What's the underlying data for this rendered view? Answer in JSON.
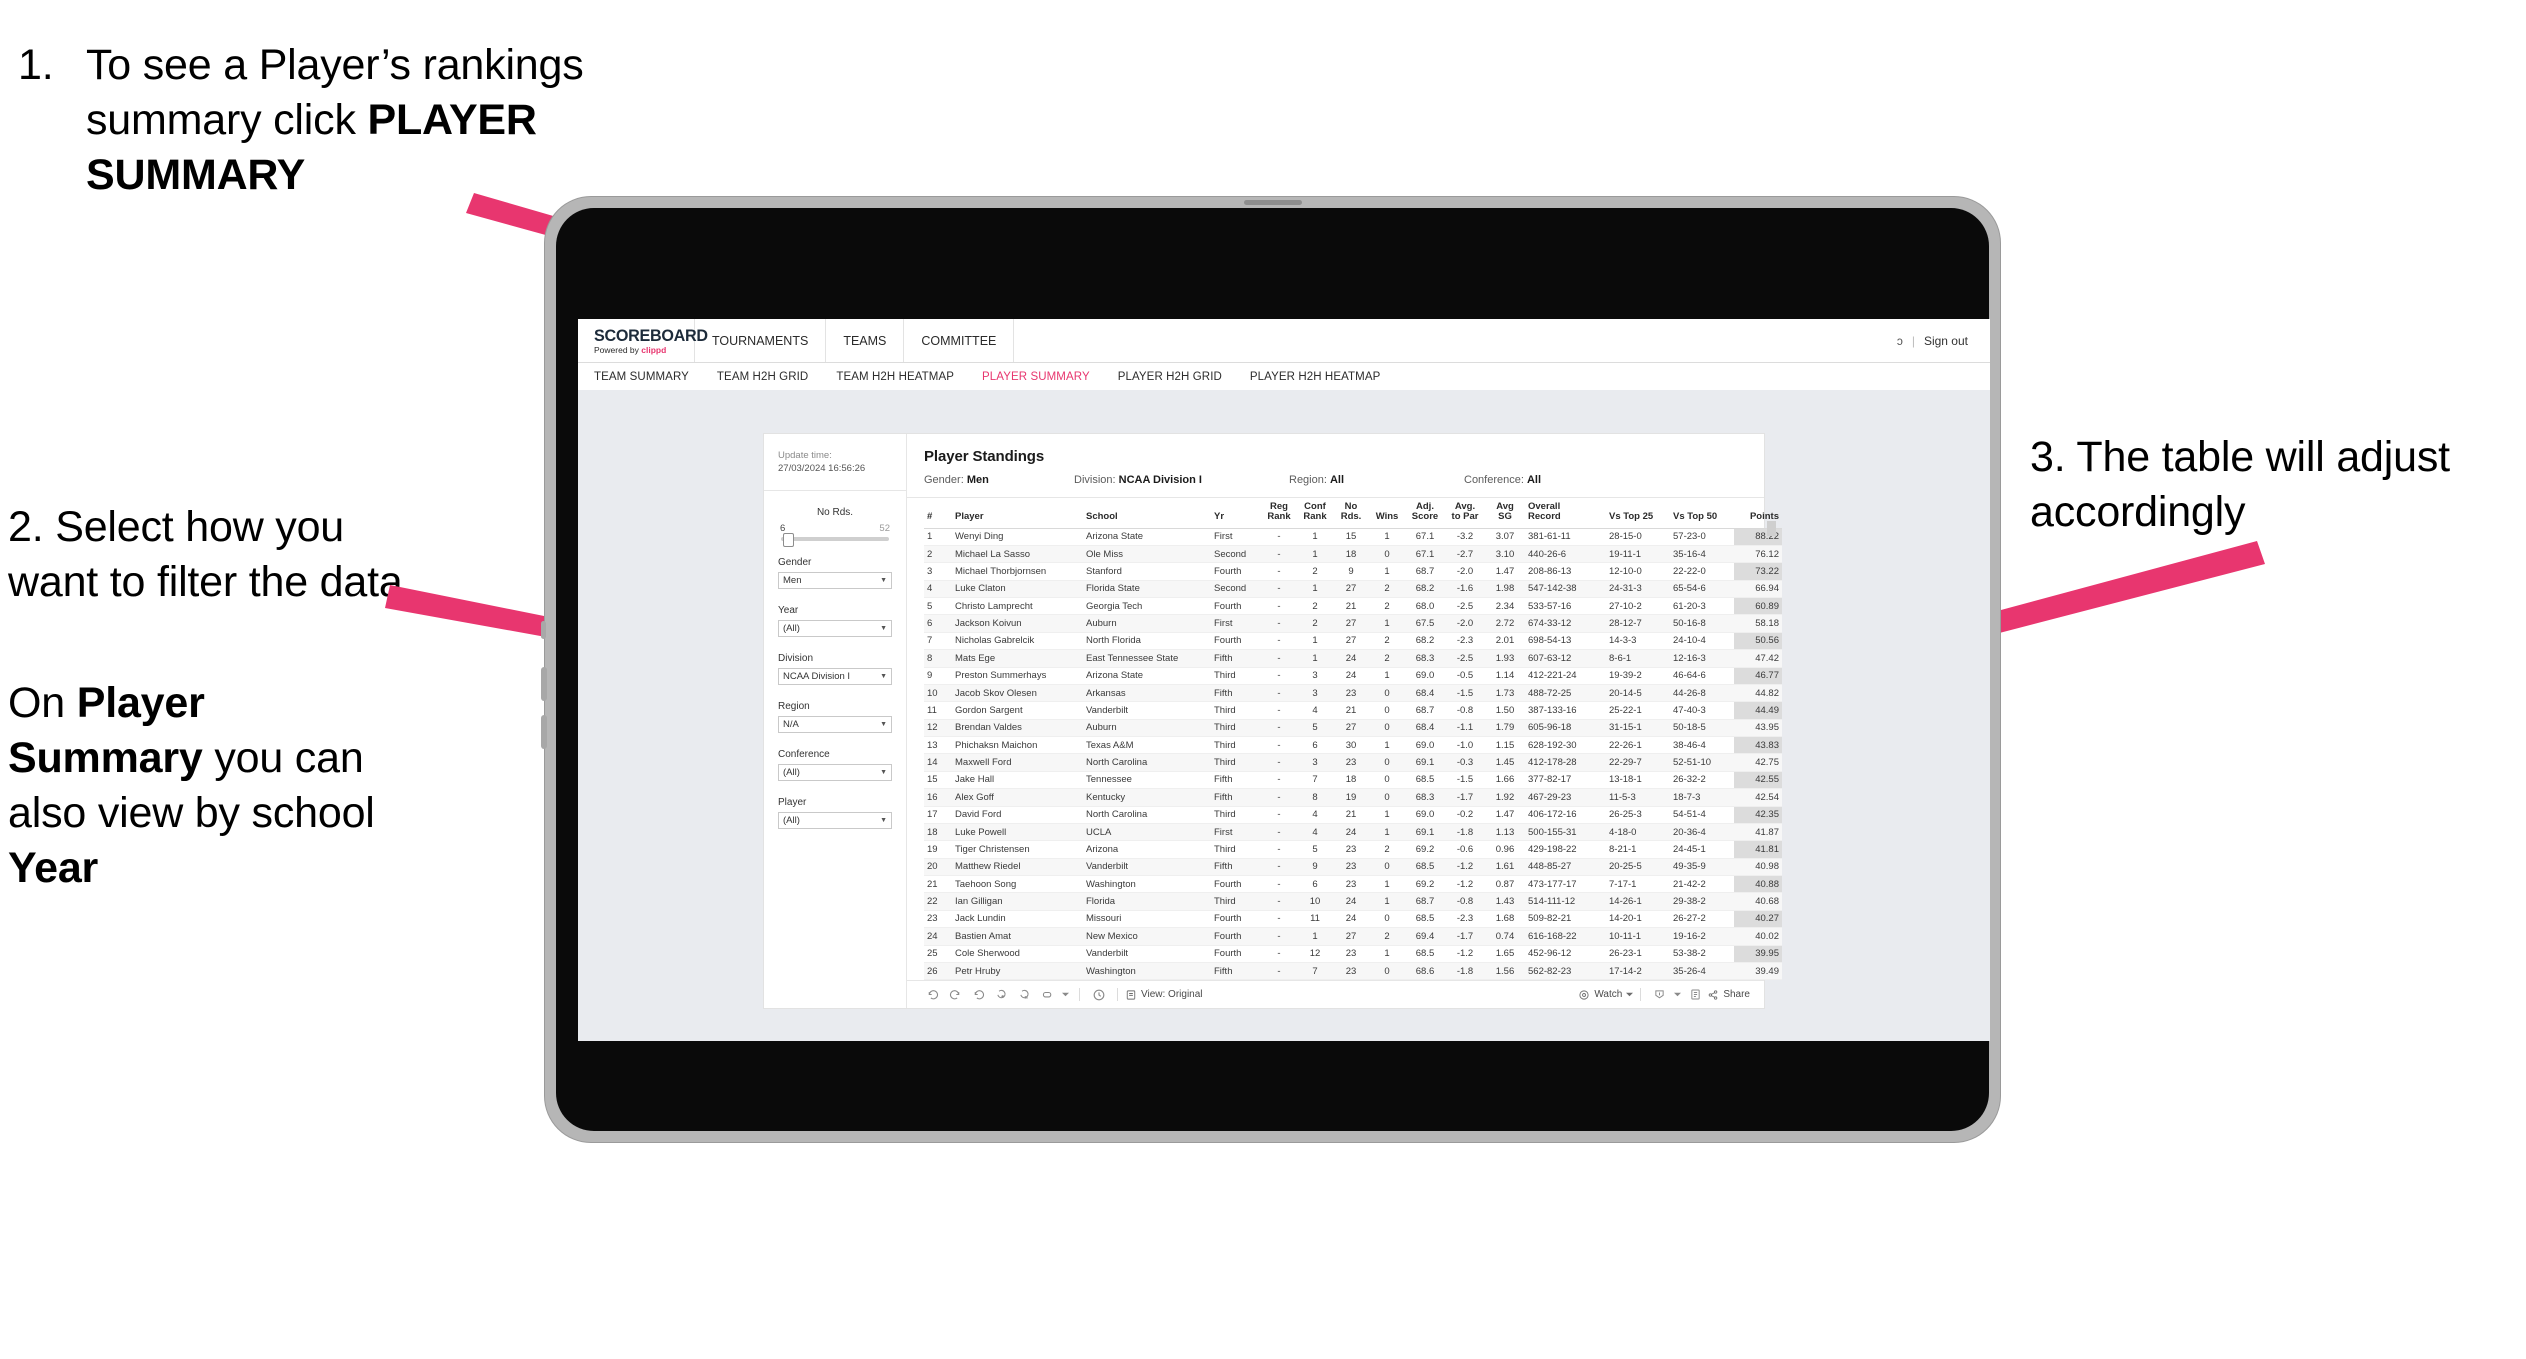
{
  "annotations": {
    "one": {
      "number": "1.",
      "line1": "To see a Player’s rankings",
      "line2_pre": "summary click ",
      "line2_bold": "PLAYER",
      "line3_bold": "SUMMARY"
    },
    "two": {
      "p1": "2. Select how you want to filter the data",
      "p2_pre": "On ",
      "p2_bold1": "Player Summary",
      "p2_mid": " you can also view by school ",
      "p2_bold2": "Year"
    },
    "three": {
      "text": "3. The table will adjust accordingly"
    }
  },
  "app": {
    "logo": {
      "main": "SCOREBOARD",
      "powered": "Powered by ",
      "brand": "clippd"
    },
    "nav": [
      {
        "label": "TOURNAMENTS"
      },
      {
        "label": "TEAMS"
      },
      {
        "label": "COMMITTEE"
      }
    ],
    "header_right": {
      "truncated": "ɔ",
      "separator": "|",
      "sign_out": "Sign out"
    },
    "subnav": [
      {
        "label": "TEAM SUMMARY",
        "active": false
      },
      {
        "label": "TEAM H2H GRID",
        "active": false
      },
      {
        "label": "TEAM H2H HEATMAP",
        "active": false
      },
      {
        "label": "PLAYER SUMMARY",
        "active": true
      },
      {
        "label": "PLAYER H2H GRID",
        "active": false
      },
      {
        "label": "PLAYER H2H HEATMAP",
        "active": false
      }
    ],
    "accent_color": "#e8366f"
  },
  "filters": {
    "update_label": "Update time:",
    "update_value": "27/03/2024 16:56:26",
    "slider": {
      "title": "No Rds.",
      "min": "6",
      "max": "52"
    },
    "controls": [
      {
        "label": "Gender",
        "value": "Men"
      },
      {
        "label": "Year",
        "value": "(All)"
      },
      {
        "label": "Division",
        "value": "NCAA Division I"
      },
      {
        "label": "Region",
        "value": "N/A"
      },
      {
        "label": "Conference",
        "value": "(All)"
      },
      {
        "label": "Player",
        "value": "(All)"
      }
    ]
  },
  "standings": {
    "title": "Player Standings",
    "summary": [
      {
        "key": "Gender: ",
        "value": "Men"
      },
      {
        "key": "Division: ",
        "value": "NCAA Division I"
      },
      {
        "key": "Region: ",
        "value": "All"
      },
      {
        "key": "Conference: ",
        "value": "All"
      }
    ],
    "columns": [
      {
        "l1": "#",
        "l2": ""
      },
      {
        "l1": "Player",
        "l2": ""
      },
      {
        "l1": "School",
        "l2": ""
      },
      {
        "l1": "Yr",
        "l2": ""
      },
      {
        "l1": "Reg",
        "l2": "Rank"
      },
      {
        "l1": "Conf",
        "l2": "Rank"
      },
      {
        "l1": "No",
        "l2": "Rds."
      },
      {
        "l1": "Wins",
        "l2": ""
      },
      {
        "l1": "Adj.",
        "l2": "Score"
      },
      {
        "l1": "Avg.",
        "l2": "to Par"
      },
      {
        "l1": "Avg",
        "l2": "SG"
      },
      {
        "l1": "Overall",
        "l2": "Record"
      },
      {
        "l1": "Vs Top 25",
        "l2": ""
      },
      {
        "l1": "Vs Top 50",
        "l2": ""
      },
      {
        "l1": "Points",
        "l2": ""
      }
    ],
    "rows": [
      [
        "1",
        "Wenyi Ding",
        "Arizona State",
        "First",
        "-",
        "1",
        "15",
        "1",
        "67.1",
        "-3.2",
        "3.07",
        "381-61-11",
        "28-15-0",
        "57-23-0",
        "88.22"
      ],
      [
        "2",
        "Michael La Sasso",
        "Ole Miss",
        "Second",
        "-",
        "1",
        "18",
        "0",
        "67.1",
        "-2.7",
        "3.10",
        "440-26-6",
        "19-11-1",
        "35-16-4",
        "76.12"
      ],
      [
        "3",
        "Michael Thorbjornsen",
        "Stanford",
        "Fourth",
        "-",
        "2",
        "9",
        "1",
        "68.7",
        "-2.0",
        "1.47",
        "208-86-13",
        "12-10-0",
        "22-22-0",
        "73.22"
      ],
      [
        "4",
        "Luke Claton",
        "Florida State",
        "Second",
        "-",
        "1",
        "27",
        "2",
        "68.2",
        "-1.6",
        "1.98",
        "547-142-38",
        "24-31-3",
        "65-54-6",
        "66.94"
      ],
      [
        "5",
        "Christo Lamprecht",
        "Georgia Tech",
        "Fourth",
        "-",
        "2",
        "21",
        "2",
        "68.0",
        "-2.5",
        "2.34",
        "533-57-16",
        "27-10-2",
        "61-20-3",
        "60.89"
      ],
      [
        "6",
        "Jackson Koivun",
        "Auburn",
        "First",
        "-",
        "2",
        "27",
        "1",
        "67.5",
        "-2.0",
        "2.72",
        "674-33-12",
        "28-12-7",
        "50-16-8",
        "58.18"
      ],
      [
        "7",
        "Nicholas Gabrelcik",
        "North Florida",
        "Fourth",
        "-",
        "1",
        "27",
        "2",
        "68.2",
        "-2.3",
        "2.01",
        "698-54-13",
        "14-3-3",
        "24-10-4",
        "50.56"
      ],
      [
        "8",
        "Mats Ege",
        "East Tennessee State",
        "Fifth",
        "-",
        "1",
        "24",
        "2",
        "68.3",
        "-2.5",
        "1.93",
        "607-63-12",
        "8-6-1",
        "12-16-3",
        "47.42"
      ],
      [
        "9",
        "Preston Summerhays",
        "Arizona State",
        "Third",
        "-",
        "3",
        "24",
        "1",
        "69.0",
        "-0.5",
        "1.14",
        "412-221-24",
        "19-39-2",
        "46-64-6",
        "46.77"
      ],
      [
        "10",
        "Jacob Skov Olesen",
        "Arkansas",
        "Fifth",
        "-",
        "3",
        "23",
        "0",
        "68.4",
        "-1.5",
        "1.73",
        "488-72-25",
        "20-14-5",
        "44-26-8",
        "44.82"
      ],
      [
        "11",
        "Gordon Sargent",
        "Vanderbilt",
        "Third",
        "-",
        "4",
        "21",
        "0",
        "68.7",
        "-0.8",
        "1.50",
        "387-133-16",
        "25-22-1",
        "47-40-3",
        "44.49"
      ],
      [
        "12",
        "Brendan Valdes",
        "Auburn",
        "Third",
        "-",
        "5",
        "27",
        "0",
        "68.4",
        "-1.1",
        "1.79",
        "605-96-18",
        "31-15-1",
        "50-18-5",
        "43.95"
      ],
      [
        "13",
        "Phichaksn Maichon",
        "Texas A&M",
        "Third",
        "-",
        "6",
        "30",
        "1",
        "69.0",
        "-1.0",
        "1.15",
        "628-192-30",
        "22-26-1",
        "38-46-4",
        "43.83"
      ],
      [
        "14",
        "Maxwell Ford",
        "North Carolina",
        "Third",
        "-",
        "3",
        "23",
        "0",
        "69.1",
        "-0.3",
        "1.45",
        "412-178-28",
        "22-29-7",
        "52-51-10",
        "42.75"
      ],
      [
        "15",
        "Jake Hall",
        "Tennessee",
        "Fifth",
        "-",
        "7",
        "18",
        "0",
        "68.5",
        "-1.5",
        "1.66",
        "377-82-17",
        "13-18-1",
        "26-32-2",
        "42.55"
      ],
      [
        "16",
        "Alex Goff",
        "Kentucky",
        "Fifth",
        "-",
        "8",
        "19",
        "0",
        "68.3",
        "-1.7",
        "1.92",
        "467-29-23",
        "11-5-3",
        "18-7-3",
        "42.54"
      ],
      [
        "17",
        "David Ford",
        "North Carolina",
        "Third",
        "-",
        "4",
        "21",
        "1",
        "69.0",
        "-0.2",
        "1.47",
        "406-172-16",
        "26-25-3",
        "54-51-4",
        "42.35"
      ],
      [
        "18",
        "Luke Powell",
        "UCLA",
        "First",
        "-",
        "4",
        "24",
        "1",
        "69.1",
        "-1.8",
        "1.13",
        "500-155-31",
        "4-18-0",
        "20-36-4",
        "41.87"
      ],
      [
        "19",
        "Tiger Christensen",
        "Arizona",
        "Third",
        "-",
        "5",
        "23",
        "2",
        "69.2",
        "-0.6",
        "0.96",
        "429-198-22",
        "8-21-1",
        "24-45-1",
        "41.81"
      ],
      [
        "20",
        "Matthew Riedel",
        "Vanderbilt",
        "Fifth",
        "-",
        "9",
        "23",
        "0",
        "68.5",
        "-1.2",
        "1.61",
        "448-85-27",
        "20-25-5",
        "49-35-9",
        "40.98"
      ],
      [
        "21",
        "Taehoon Song",
        "Washington",
        "Fourth",
        "-",
        "6",
        "23",
        "1",
        "69.2",
        "-1.2",
        "0.87",
        "473-177-17",
        "7-17-1",
        "21-42-2",
        "40.88"
      ],
      [
        "22",
        "Ian Gilligan",
        "Florida",
        "Third",
        "-",
        "10",
        "24",
        "1",
        "68.7",
        "-0.8",
        "1.43",
        "514-111-12",
        "14-26-1",
        "29-38-2",
        "40.68"
      ],
      [
        "23",
        "Jack Lundin",
        "Missouri",
        "Fourth",
        "-",
        "11",
        "24",
        "0",
        "68.5",
        "-2.3",
        "1.68",
        "509-82-21",
        "14-20-1",
        "26-27-2",
        "40.27"
      ],
      [
        "24",
        "Bastien Amat",
        "New Mexico",
        "Fourth",
        "-",
        "1",
        "27",
        "2",
        "69.4",
        "-1.7",
        "0.74",
        "616-168-22",
        "10-11-1",
        "19-16-2",
        "40.02"
      ],
      [
        "25",
        "Cole Sherwood",
        "Vanderbilt",
        "Fourth",
        "-",
        "12",
        "23",
        "1",
        "68.5",
        "-1.2",
        "1.65",
        "452-96-12",
        "26-23-1",
        "53-38-2",
        "39.95"
      ],
      [
        "26",
        "Petr Hruby",
        "Washington",
        "Fifth",
        "-",
        "7",
        "23",
        "0",
        "68.6",
        "-1.8",
        "1.56",
        "562-82-23",
        "17-14-2",
        "35-26-4",
        "39.49"
      ]
    ]
  },
  "toolbar": {
    "view_label": "View: Original",
    "watch_label": "Watch",
    "share_label": "Share"
  }
}
